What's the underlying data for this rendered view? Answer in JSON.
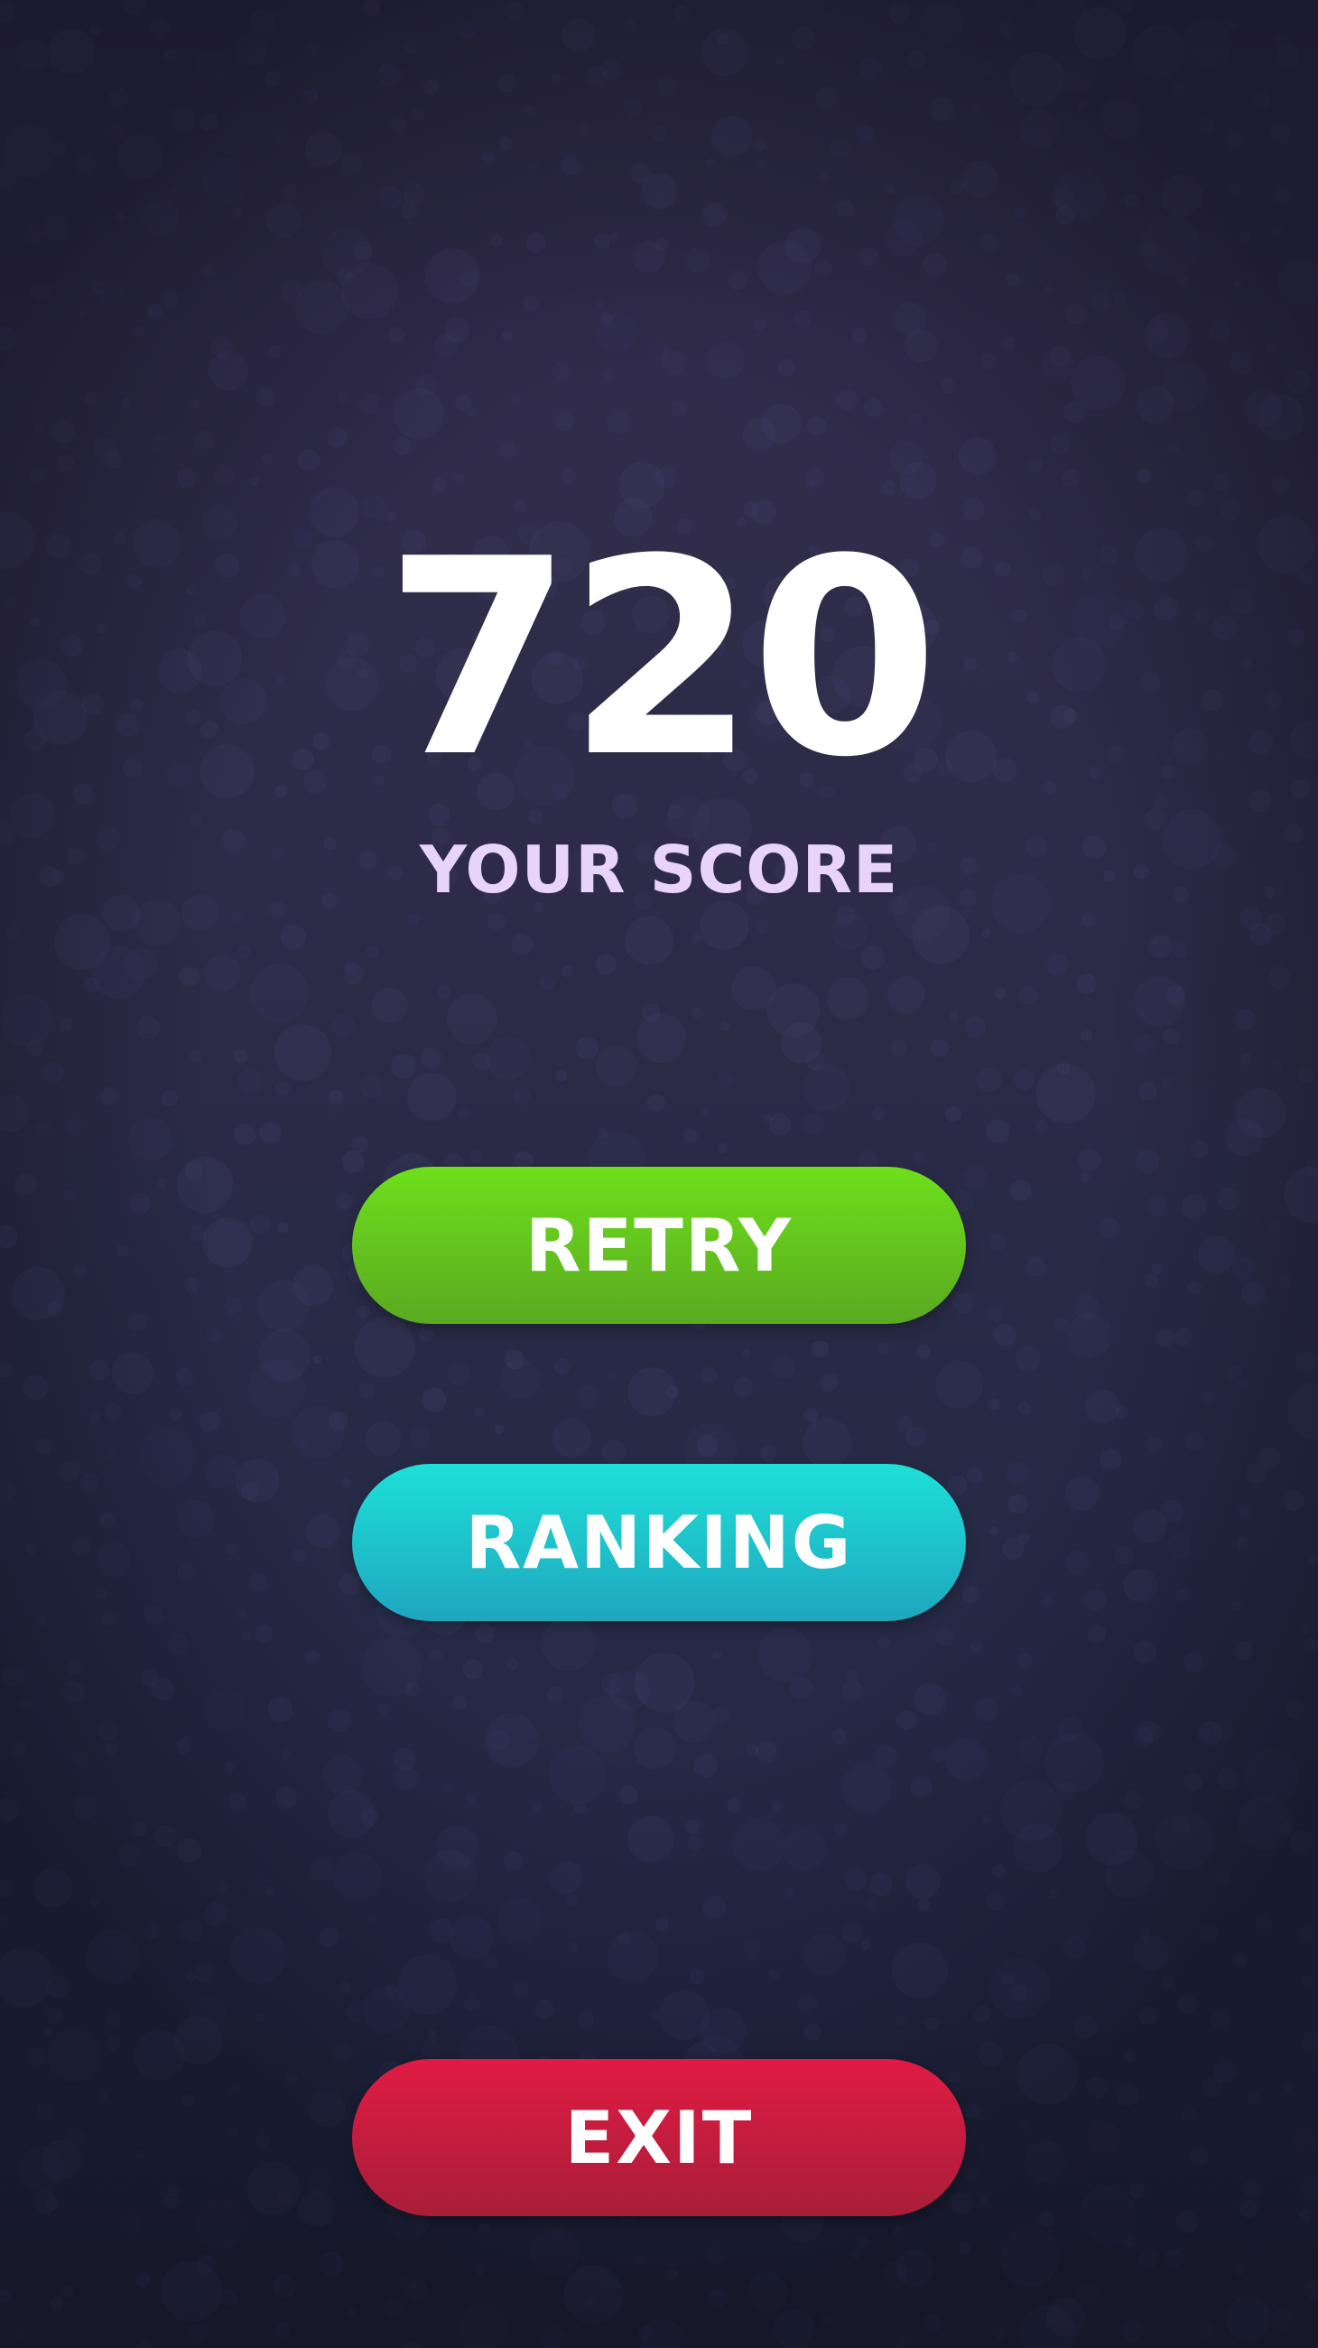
{
  "score": {
    "value": "720",
    "label": "YOUR SCORE"
  },
  "buttons": {
    "retry": "RETRY",
    "ranking": "RANKING",
    "exit": "EXIT"
  },
  "colors": {
    "background": "#2d2b47",
    "score_text": "#ffffff",
    "label_text": "#e8d4f9",
    "retry": "#64c41e",
    "ranking": "#1ec4cc",
    "exit": "#c81d3e"
  }
}
